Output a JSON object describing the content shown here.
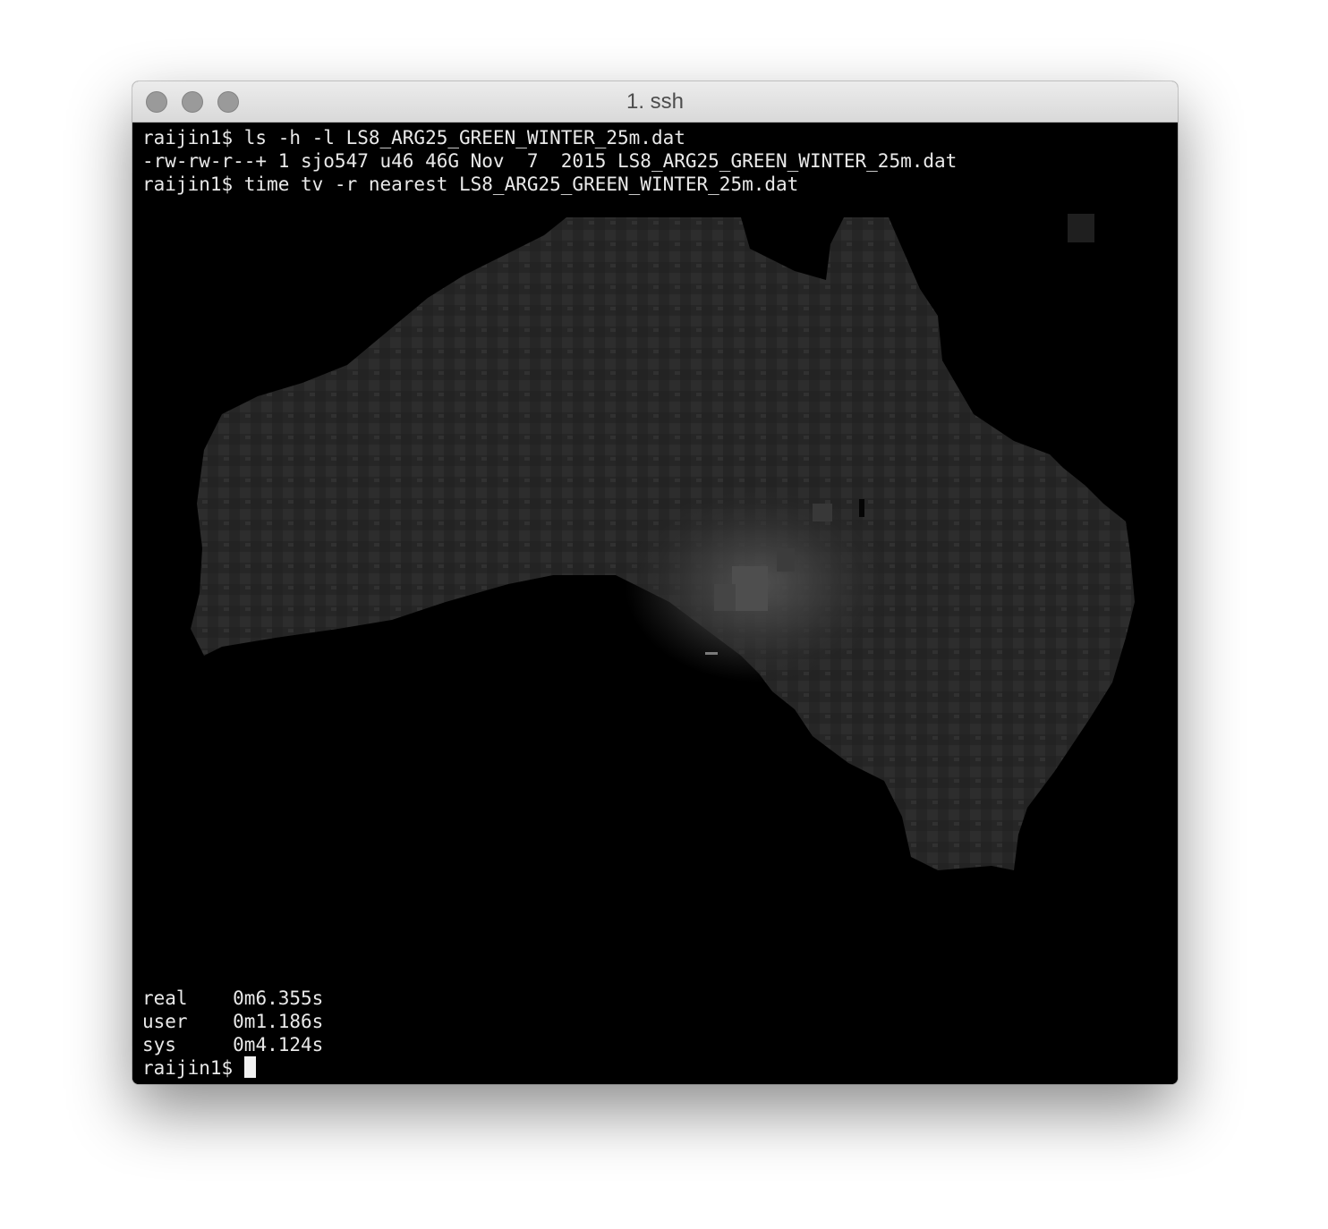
{
  "window": {
    "title": "1. ssh"
  },
  "terminal": {
    "lines": {
      "l1": "raijin1$ ls -h -l LS8_ARG25_GREEN_WINTER_25m.dat",
      "l2": "-rw-rw-r--+ 1 sjo547 u46 46G Nov  7  2015 LS8_ARG25_GREEN_WINTER_25m.dat",
      "l3": "raijin1$ time tv -r nearest LS8_ARG25_GREEN_WINTER_25m.dat",
      "real": "real\t0m6.355s",
      "user": "user\t0m1.186s",
      "sys": "sys\t0m4.124s",
      "prompt": "raijin1$ "
    }
  },
  "image": {
    "icon": "australia-landsat-greyscale-render",
    "land_color": "#2b2b2b",
    "bright_color": "#4a4a4a",
    "background": "#000000"
  }
}
